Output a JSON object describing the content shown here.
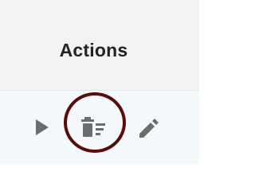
{
  "table": {
    "header": {
      "actions_label": "Actions"
    },
    "row": {
      "actions": [
        {
          "name": "play-icon",
          "color": "#6d6d6d"
        },
        {
          "name": "delete-list-icon",
          "color": "#6d6d6d"
        },
        {
          "name": "pencil-icon",
          "color": "#6d6d6d"
        }
      ]
    }
  },
  "highlight": {
    "color": "#5c0a0a",
    "target": "delete-list-icon"
  }
}
